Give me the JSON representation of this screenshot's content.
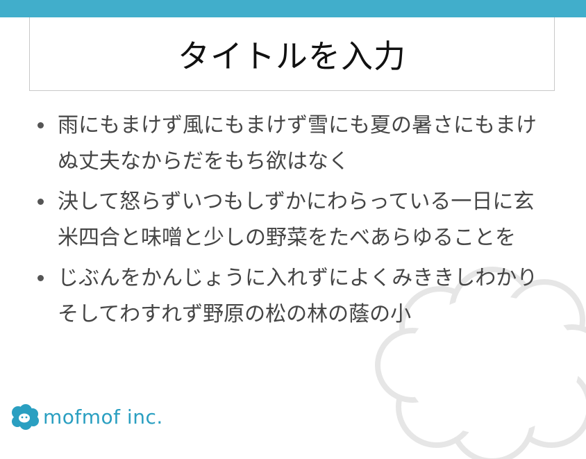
{
  "slide": {
    "title": "タイトルを入力",
    "bullets": [
      "雨にもまけず風にもまけず雪にも夏の暑さにもまけぬ丈夫なからだをもち欲はなく",
      "決して怒らずいつもしずかにわらっている一日に玄米四合と味噌と少しの野菜をたべあらゆることを",
      "じぶんをかんじょうに入れずによくみききしわかりそしてわすれず野原の松の林の蔭の小"
    ]
  },
  "footer": {
    "logo_text": "mofmof inc."
  },
  "colors": {
    "accent": "#41aecb",
    "logo": "#2a9fc1",
    "body_text": "#454545"
  },
  "icons": {
    "logo": "sheep-logo-icon",
    "background": "sheep-cloud-decoration"
  }
}
